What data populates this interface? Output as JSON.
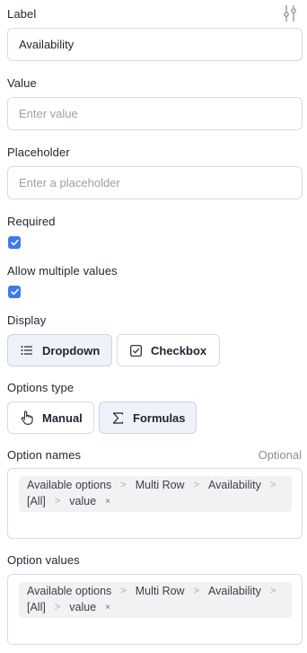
{
  "label": {
    "title": "Label",
    "value": "Availability"
  },
  "value_field": {
    "title": "Value",
    "placeholder": "Enter value"
  },
  "placeholder_field": {
    "title": "Placeholder",
    "placeholder": "Enter a placeholder"
  },
  "required": {
    "title": "Required",
    "checked": true
  },
  "allow_multiple": {
    "title": "Allow multiple values",
    "checked": true
  },
  "display": {
    "title": "Display",
    "options": [
      {
        "label": "Dropdown",
        "icon": "list-icon",
        "selected": true
      },
      {
        "label": "Checkbox",
        "icon": "checkbox-icon",
        "selected": false
      }
    ]
  },
  "options_type": {
    "title": "Options type",
    "options": [
      {
        "label": "Manual",
        "icon": "hand-pointer-icon",
        "selected": false
      },
      {
        "label": "Formulas",
        "icon": "sigma-icon",
        "selected": true
      }
    ]
  },
  "option_names": {
    "title": "Option names",
    "optional_label": "Optional",
    "path": [
      "Available options",
      "Multi Row",
      "Availability",
      "[All]",
      "value"
    ],
    "remove_glyph": "×"
  },
  "option_values": {
    "title": "Option values",
    "path": [
      "Available options",
      "Multi Row",
      "Availability",
      "[All]",
      "value"
    ],
    "remove_glyph": "×"
  },
  "colors": {
    "accent": "#3d7bea",
    "selected_bg": "#eef3fb",
    "border": "#d8dbe0",
    "chip_bg": "#f1f2f4"
  }
}
